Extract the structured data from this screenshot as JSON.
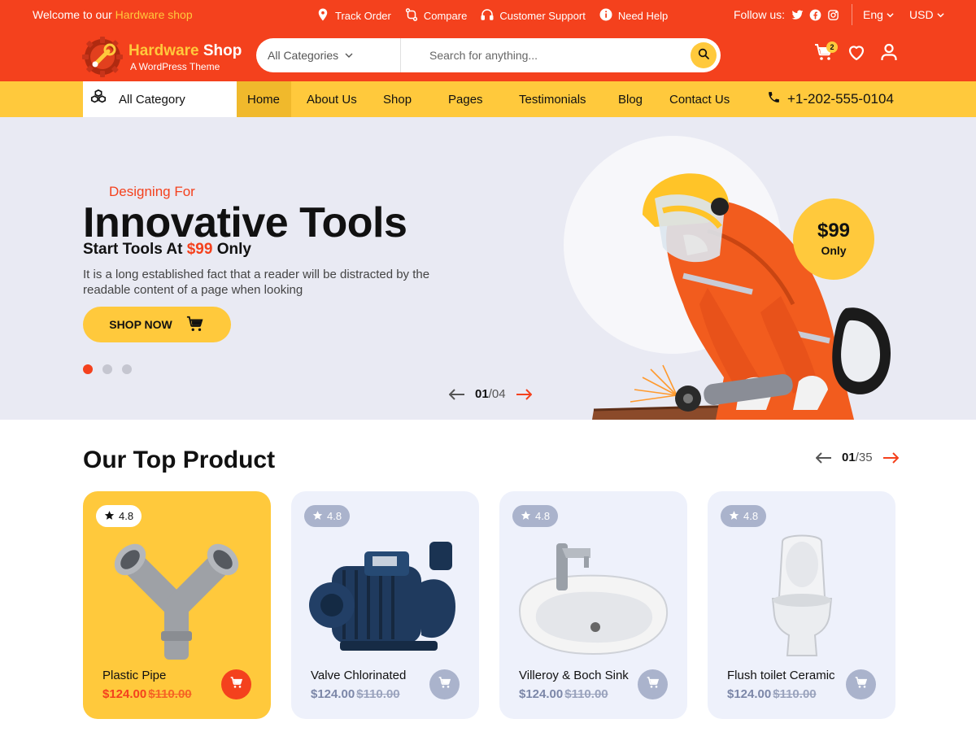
{
  "topbar": {
    "welcome_prefix": "Welcome to our ",
    "welcome_accent": "Hardware shop",
    "links": [
      {
        "label": "Track Order",
        "icon": "location-pin-icon"
      },
      {
        "label": "Compare",
        "icon": "compare-icon"
      },
      {
        "label": "Customer Support",
        "icon": "headset-icon"
      },
      {
        "label": "Need Help",
        "icon": "info-icon"
      }
    ],
    "follow_label": "Follow us:",
    "social": [
      "twitter-icon",
      "facebook-icon",
      "instagram-icon"
    ],
    "language": "Eng",
    "currency": "USD"
  },
  "header": {
    "logo_title_a": "Hardware",
    "logo_title_b": " Shop",
    "logo_sub": "A WordPress Theme",
    "search": {
      "category": "All Categories",
      "placeholder": "Search for anything..."
    },
    "cart_count": "2"
  },
  "nav": {
    "all_category": "All Category",
    "links": [
      "Home",
      "About Us",
      "Shop",
      "Pages",
      "Testimonials",
      "Blog",
      "Contact Us"
    ],
    "active": "Home",
    "phone": "+1-202-555-0104"
  },
  "hero": {
    "pretitle": "Designing For",
    "title": "Innovative Tools",
    "subtitle_a": "Start Tools At ",
    "subtitle_price": "$99",
    "subtitle_b": " Only",
    "description": "It is a long established fact that a reader will be distracted by the readable content of a page when looking",
    "button": "SHOP NOW",
    "badge_price": "$99",
    "badge_label": "Only",
    "pager_current": "01",
    "pager_total": "/04",
    "slides": 3,
    "active_slide": 0
  },
  "products": {
    "title": "Our Top Product",
    "pager_current": "01",
    "pager_total": "/35",
    "items": [
      {
        "name": "Plastic Pipe",
        "price": "$124.00",
        "old_price": "$110.00",
        "rating": "4.8",
        "featured": true,
        "icon": "pipe-fitting-icon"
      },
      {
        "name": "Valve Chlorinated",
        "price": "$124.00",
        "old_price": "$110.00",
        "rating": "4.8",
        "featured": false,
        "icon": "water-pump-icon"
      },
      {
        "name": "Villeroy & Boch Sink",
        "price": "$124.00",
        "old_price": "$110.00",
        "rating": "4.8",
        "featured": false,
        "icon": "sink-icon"
      },
      {
        "name": "Flush toilet Ceramic",
        "price": "$124.00",
        "old_price": "$110.00",
        "rating": "4.8",
        "featured": false,
        "icon": "toilet-icon"
      }
    ]
  },
  "colors": {
    "primary": "#f4411d",
    "accent": "#ffc93c",
    "hero_bg": "#e9eaf3",
    "card_bg": "#eef1fb"
  }
}
